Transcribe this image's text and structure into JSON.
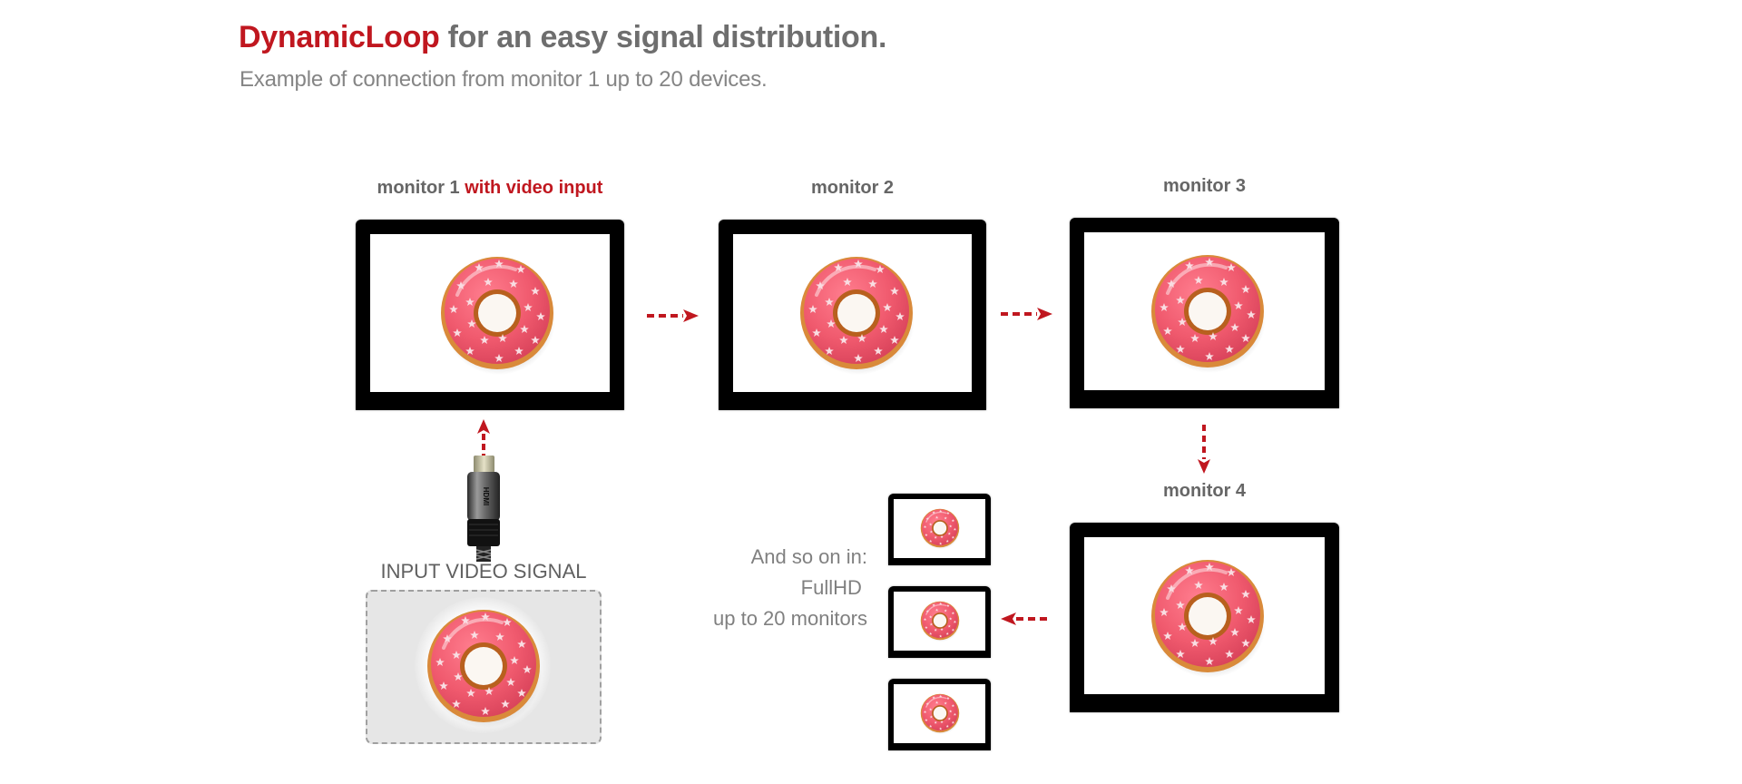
{
  "header": {
    "brand": "DynamicLoop",
    "title_rest": " for an easy signal distribution.",
    "subtitle": "Example of connection from monitor 1 up to 20 devices."
  },
  "monitors": [
    {
      "name": "monitor 1",
      "suffix": " with video input"
    },
    {
      "name": "monitor 2",
      "suffix": ""
    },
    {
      "name": "monitor 3",
      "suffix": ""
    },
    {
      "name": "monitor 4",
      "suffix": ""
    }
  ],
  "input": {
    "label": "INPUT VIDEO SIGNAL",
    "connector_icon": "hdmi-connector-icon",
    "connector_text": "HDMI"
  },
  "more": {
    "line1": "And so on in:",
    "line2": "FullHD ",
    "line3": "up to 20 monitors"
  },
  "flow": [
    "input -> monitor 1",
    "monitor 1 -> monitor 2",
    "monitor 2 -> monitor 3",
    "monitor 3 -> monitor 4",
    "monitor 4 -> more monitors"
  ],
  "extra_monitor_count": 3,
  "colors": {
    "accent": "#c0171f",
    "title_gray": "#6e6e6e",
    "text_gray": "#808080",
    "frame": "#000000",
    "input_bg": "#e6e6e6",
    "glaze": "#f05a6e",
    "dough": "#d98a3a"
  }
}
